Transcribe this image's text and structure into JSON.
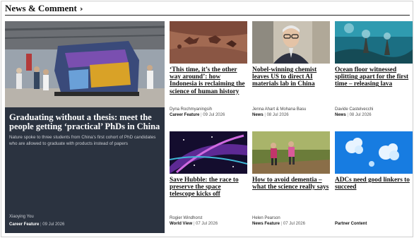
{
  "section": {
    "title": "News & Comment",
    "chevron": "chevron-right-icon"
  },
  "lead": {
    "title": "Graduating without a thesis: meet the people getting ‘practical’ PhDs in China",
    "standfirst": "Nature spoke to three students from China's first cohort of PhD candidates who are allowed to graduate with products instead of papers",
    "author": "Xiaoying You",
    "type": "Career Feature",
    "date": "09 Jul 2026"
  },
  "cards": [
    {
      "title": "‘This time, it’s the other way around’: how Indonesia is reclaiming the science of human history",
      "author": "Dyna Rochmyaningsih",
      "type": "Career Feature",
      "date": "09 Jul 2026"
    },
    {
      "title": "Nobel-winning chemist leaves US to direct AI materials lab in China",
      "author": "Jenna Ahart & Mohana Basu",
      "type": "News",
      "date": "08 Jul 2026"
    },
    {
      "title": "Ocean floor witnessed splitting apart for the first time – releasing lava",
      "author": "Davide Castelvecchi",
      "type": "News",
      "date": "08 Jul 2026"
    },
    {
      "title": "Save Hubble: the race to preserve the space telescope kicks off",
      "author": "Rogier Windhorst",
      "type": "World View",
      "date": "07 Jul 2026"
    },
    {
      "title": "How to avoid dementia – what the science really says",
      "author": "Helen Pearson",
      "type": "News Feature",
      "date": "07 Jul 2026"
    },
    {
      "title": "ADCs need good linkers to succeed",
      "author": "",
      "type": "Partner Content",
      "date": ""
    }
  ]
}
